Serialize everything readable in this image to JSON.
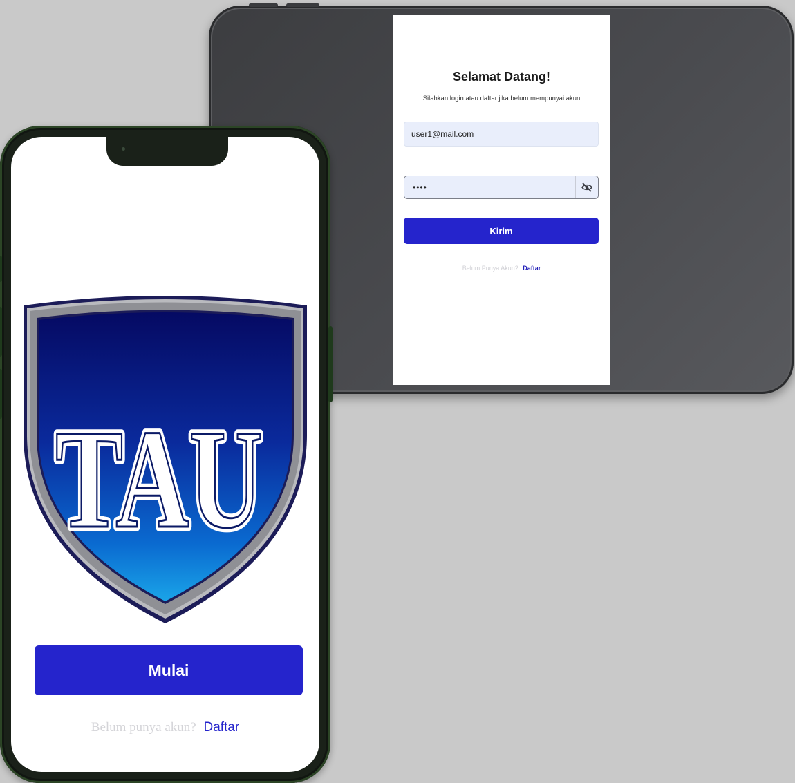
{
  "tablet": {
    "title": "Selamat Datang!",
    "subtitle": "Silahkan login atau daftar jika belum mempunyai akun",
    "email_value": "user1@mail.com",
    "password_value": "••••",
    "password_toggle_icon": "eye-slash-icon",
    "submit_label": "Kirim",
    "footer_prompt": "Belum Punya Akun?",
    "footer_link": "Daftar"
  },
  "phone": {
    "logo_text": "TAU",
    "start_label": "Mulai",
    "footer_prompt": "Belum punya akun?",
    "footer_link": "Daftar"
  },
  "colors": {
    "primary_button": "#2524cc",
    "link": "#2320b8",
    "background": "#c9c9c9",
    "tablet_frame": "#45464a",
    "phone_frame": "#1a2119",
    "input_bg": "#e9eefb"
  }
}
